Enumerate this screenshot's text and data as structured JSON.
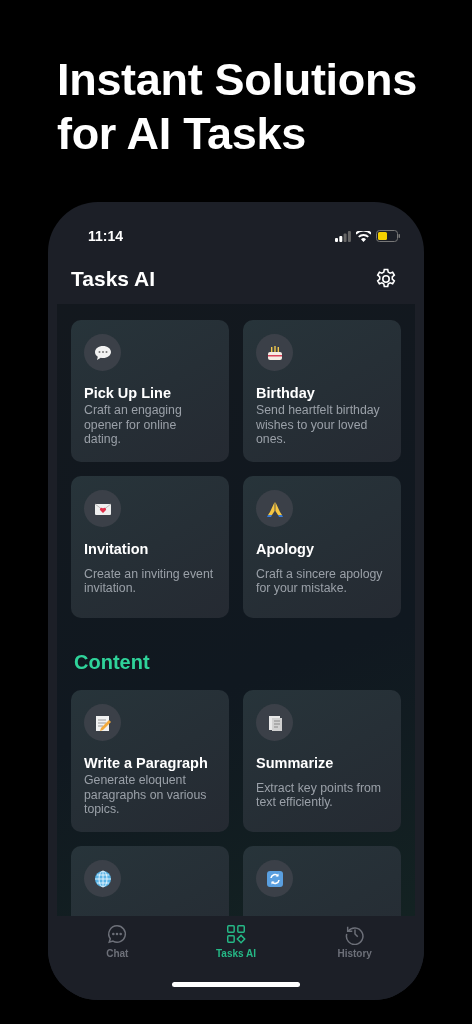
{
  "headline": {
    "lines": [
      "Instant Solutions",
      "for AI Tasks"
    ]
  },
  "status_bar": {
    "time": "11:14"
  },
  "app_bar": {
    "title": "Tasks AI"
  },
  "sections": [
    {
      "cards": [
        {
          "kind": "speech",
          "title": "Pick Up Line",
          "description": "Craft an engaging opener for online dating."
        },
        {
          "kind": "cake",
          "title": "Birthday",
          "description": "Send heartfelt birthday wishes to your loved ones."
        },
        {
          "kind": "envelope",
          "title": "Invitation",
          "description": "Create an inviting event invitation."
        },
        {
          "kind": "hands",
          "title": "Apology",
          "description": "Craft a sincere apology for your mistake."
        }
      ]
    },
    {
      "title": "Content",
      "cards": [
        {
          "kind": "memo",
          "title": "Write a Paragraph",
          "description": "Generate eloquent paragraphs on various topics."
        },
        {
          "kind": "document",
          "title": "Summarize",
          "description": "Extract key points from text efficiently."
        },
        {
          "kind": "globe"
        },
        {
          "kind": "refresh"
        }
      ]
    }
  ],
  "tab_bar": [
    {
      "kind": "chat",
      "label": "Chat",
      "selected": false
    },
    {
      "kind": "grid",
      "label": "Tasks AI",
      "selected": true
    },
    {
      "kind": "history",
      "label": "History",
      "selected": false
    }
  ]
}
